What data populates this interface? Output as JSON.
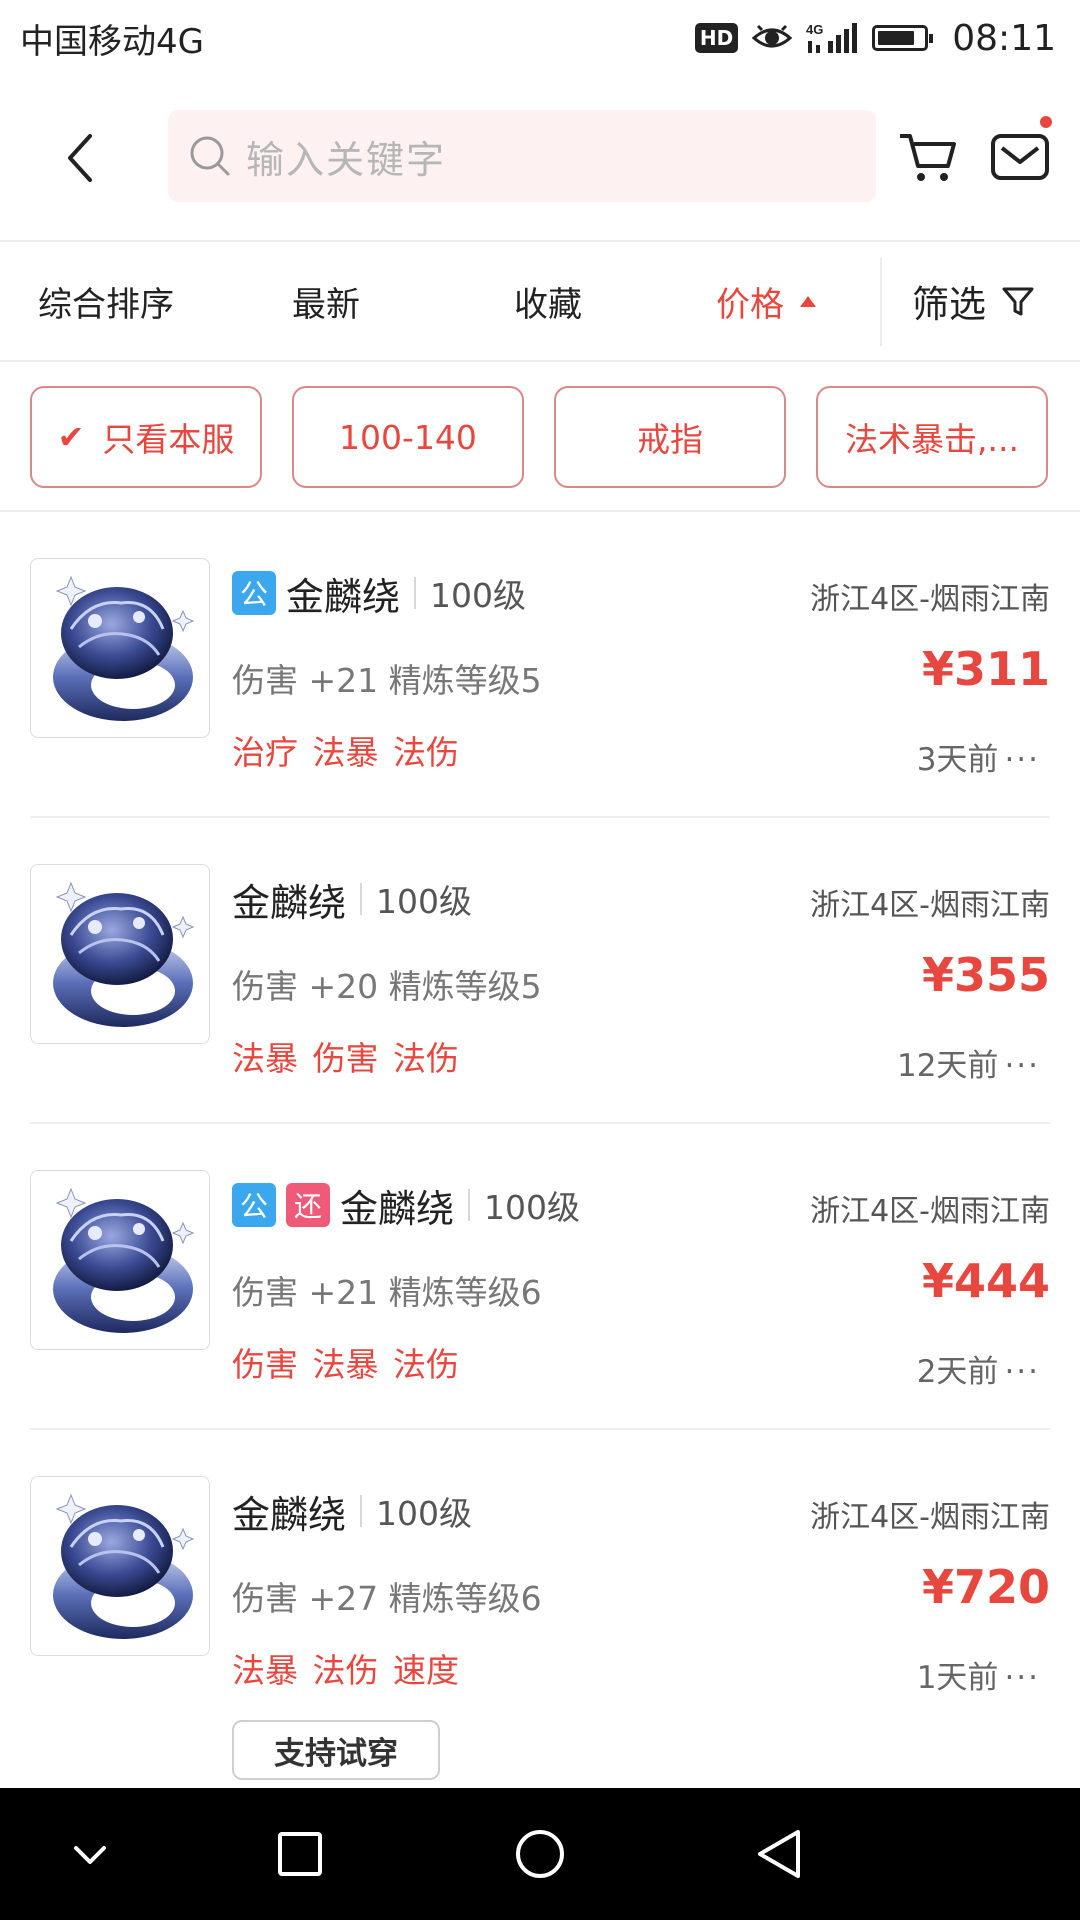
{
  "status_bar": {
    "carrier": "中国移动4G",
    "hd": "HD",
    "network": "4G",
    "time": "08:11"
  },
  "header": {
    "search_placeholder": "输入关键字"
  },
  "sort_bar": {
    "items": [
      "综合排序",
      "最新",
      "收藏",
      "价格"
    ],
    "active": "价格",
    "filter_label": "筛选"
  },
  "chips": [
    {
      "label": "只看本服",
      "checked": true
    },
    {
      "label": "100-140"
    },
    {
      "label": "戒指"
    },
    {
      "label": "法术暴击,..."
    }
  ],
  "listings": [
    {
      "tags": [
        "公"
      ],
      "name": "金麟绕",
      "level": "100级",
      "server": "浙江4区-烟雨江南",
      "attr": "伤害 +21 精炼等级5",
      "price": "¥311",
      "effects": "治疗 法暴 法伤",
      "time": "3天前"
    },
    {
      "tags": [],
      "name": "金麟绕",
      "level": "100级",
      "server": "浙江4区-烟雨江南",
      "attr": "伤害 +20 精炼等级5",
      "price": "¥355",
      "effects": "法暴 伤害 法伤",
      "time": "12天前"
    },
    {
      "tags": [
        "公",
        "还"
      ],
      "name": "金麟绕",
      "level": "100级",
      "server": "浙江4区-烟雨江南",
      "attr": "伤害 +21 精炼等级6",
      "price": "¥444",
      "effects": "伤害 法暴 法伤",
      "time": "2天前"
    },
    {
      "tags": [],
      "name": "金麟绕",
      "level": "100级",
      "server": "浙江4区-烟雨江南",
      "attr": "伤害 +27 精炼等级6",
      "price": "¥720",
      "effects": "法暴 法伤 速度",
      "time": "1天前",
      "badge": "支持试穿"
    }
  ],
  "more_glyph": "···",
  "colors": {
    "accent": "#e7473f",
    "tag_public": "#3aa7ee",
    "tag_return": "#ee5a78",
    "search_bg": "#fdf1f1"
  },
  "icons": [
    "back-icon",
    "search-icon",
    "cart-icon",
    "mail-icon",
    "filter-icon",
    "check-icon",
    "ring-image",
    "nav-back-icon",
    "nav-home-icon",
    "nav-recents-icon",
    "nav-hide-icon"
  ]
}
